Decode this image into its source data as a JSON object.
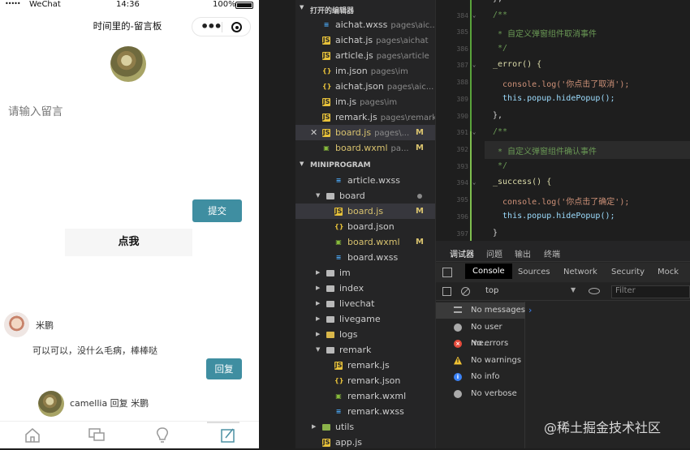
{
  "phone": {
    "status": {
      "carrier": "WeChat",
      "time": "14:36",
      "battery": "100%"
    },
    "nav_title": "时间里的-留言板",
    "input_placeholder": "请输入留言",
    "submit_label": "提交",
    "click_label": "点我",
    "comment": {
      "name": "米鹏",
      "text": "可以可以，没什么毛病，棒棒哒"
    },
    "reply_label": "回复",
    "reply_line": "camellia 回复 米鹏",
    "tabs": [
      "home-icon",
      "chat-icon",
      "bulb-icon",
      "edit-icon"
    ]
  },
  "explorer": {
    "open_editors_title": "打开的编辑器",
    "open_editors": [
      {
        "name": "aichat.wxss",
        "path": "pages\\aic...",
        "icon": "css",
        "badge": ""
      },
      {
        "name": "aichat.js",
        "path": "pages\\aichat",
        "icon": "js",
        "badge": ""
      },
      {
        "name": "article.js",
        "path": "pages\\article",
        "icon": "js",
        "badge": ""
      },
      {
        "name": "im.json",
        "path": "pages\\im",
        "icon": "json",
        "badge": ""
      },
      {
        "name": "aichat.json",
        "path": "pages\\aic...",
        "icon": "json",
        "badge": ""
      },
      {
        "name": "im.js",
        "path": "pages\\im",
        "icon": "js",
        "badge": ""
      },
      {
        "name": "remark.js",
        "path": "pages\\remark",
        "icon": "js",
        "badge": ""
      },
      {
        "name": "board.js",
        "path": "pages\\...",
        "icon": "js",
        "badge": "M"
      },
      {
        "name": "board.wxml",
        "path": "pa...",
        "icon": "wxml",
        "badge": "M"
      }
    ],
    "project_title": "MINIPROGRAM",
    "tree": [
      {
        "name": "article.wxss",
        "icon": "css",
        "indent": 2,
        "badge": ""
      },
      {
        "name": "board",
        "icon": "folder",
        "indent": 1,
        "badge": ""
      },
      {
        "name": "board.js",
        "icon": "js",
        "indent": 2,
        "badge": "M"
      },
      {
        "name": "board.json",
        "icon": "json",
        "indent": 2,
        "badge": ""
      },
      {
        "name": "board.wxml",
        "icon": "wxml",
        "indent": 2,
        "badge": "M"
      },
      {
        "name": "board.wxss",
        "icon": "css",
        "indent": 2,
        "badge": ""
      },
      {
        "name": "im",
        "icon": "folder",
        "indent": 1,
        "badge": ""
      },
      {
        "name": "index",
        "icon": "folder",
        "indent": 1,
        "badge": ""
      },
      {
        "name": "livechat",
        "icon": "folder",
        "indent": 1,
        "badge": ""
      },
      {
        "name": "livegame",
        "icon": "folder",
        "indent": 1,
        "badge": ""
      },
      {
        "name": "logs",
        "icon": "folder-logs",
        "indent": 1,
        "badge": ""
      },
      {
        "name": "remark",
        "icon": "folder",
        "indent": 1,
        "badge": ""
      },
      {
        "name": "remark.js",
        "icon": "js",
        "indent": 2,
        "badge": ""
      },
      {
        "name": "remark.json",
        "icon": "json",
        "indent": 2,
        "badge": ""
      },
      {
        "name": "remark.wxml",
        "icon": "wxml",
        "indent": 2,
        "badge": ""
      },
      {
        "name": "remark.wxss",
        "icon": "css",
        "indent": 2,
        "badge": ""
      },
      {
        "name": "utils",
        "icon": "folder-utils",
        "indent": 0,
        "badge": ""
      },
      {
        "name": "app.js",
        "icon": "js",
        "indent": 0,
        "badge": ""
      }
    ]
  },
  "code": {
    "line_numbers": [
      "384",
      "385",
      "386",
      "387",
      "388",
      "389",
      "390",
      "391",
      "392",
      "393",
      "394",
      "395",
      "396",
      "397"
    ],
    "lines": [
      "},",
      "/**",
      " * 自定义弹窗组件取消事件",
      " */",
      "_error() {",
      "  console.log('你点击了取消');",
      "  this.popup.hidePopup();",
      "},",
      "/**",
      " * 自定义弹窗组件确认事件",
      " */",
      "_success() {",
      "  console.log('你点击了确定');",
      "  this.popup.hidePopup();",
      "}"
    ]
  },
  "console": {
    "debug_tabs": [
      "调试器",
      "问题",
      "输出",
      "终端"
    ],
    "dev_tabs": [
      "Console",
      "Sources",
      "Network",
      "Security",
      "Mock"
    ],
    "context": "top",
    "filter_placeholder": "Filter",
    "messages": [
      "No messages",
      "No user me...",
      "No errors",
      "No warnings",
      "No info",
      "No verbose"
    ],
    "prompt": "›"
  },
  "watermark": "@稀土掘金技术社区",
  "colors": {
    "accent": "#3f8ea1",
    "editor_bg": "#1e1e1e",
    "sidebar_bg": "#252526"
  }
}
